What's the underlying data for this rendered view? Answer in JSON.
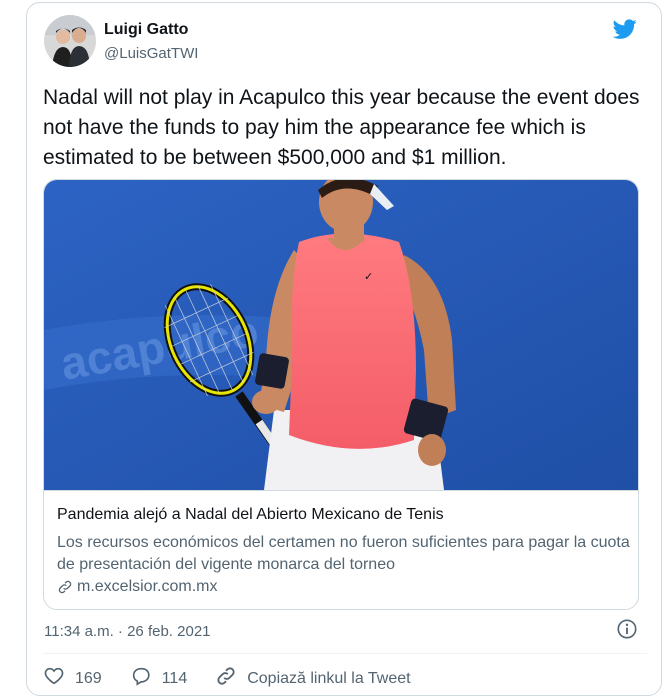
{
  "author": {
    "name": "Luigi Gatto",
    "handle": "@LuisGatTWI"
  },
  "tweet": {
    "text": "Nadal will not play in Acapulco this year because the event does not have the funds to pay him the appearance fee which is estimated to be between $500,000 and $1 million."
  },
  "card": {
    "title": "Pandemia alejó a Nadal del Abierto Mexicano de Tenis",
    "description": "Los recursos económicos del certamen no fueron suficientes para pagar la cuota de presentación del vigente monarca del torneo",
    "domain": "m.excelsior.com.mx"
  },
  "meta": {
    "timestamp": "11:34 a.m. · 26 feb. 2021"
  },
  "actions": {
    "likes": "169",
    "replies": "114",
    "copy_link": "Copiază linkul la Tweet"
  },
  "colors": {
    "twitter_blue": "#1d9bf0",
    "secondary_text": "#536471",
    "border": "#cfd9de",
    "court_blue": "#2b5bb8",
    "shirt_coral": "#ff6f73"
  },
  "icons": [
    "twitter-bird-icon",
    "link-icon",
    "info-icon",
    "heart-icon",
    "reply-icon",
    "copy-link-icon"
  ]
}
